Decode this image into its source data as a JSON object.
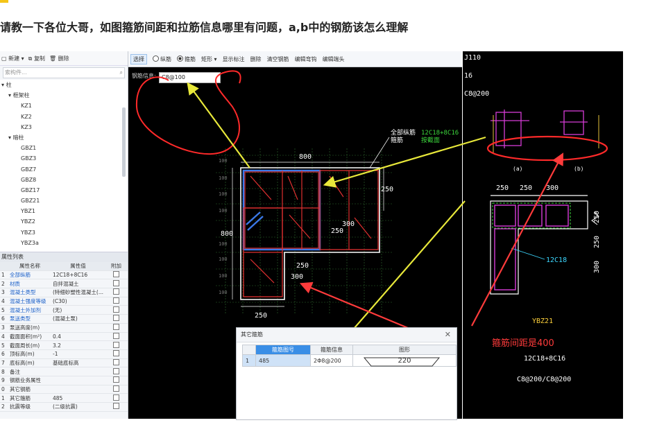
{
  "question": "请教一下各位大哥，如图箍筋间距和拉筋信息哪里有问题，a,b中的钢筋该怎么理解",
  "left_panel": {
    "toolbar": {
      "new": "新建",
      "copy": "复制",
      "delete": "删除"
    },
    "search_placeholder": "索构件...",
    "tree": [
      "柱",
      "框架柱",
      "KZ1",
      "KZ2",
      "KZ3",
      "暗柱",
      "GBZ1",
      "GBZ3",
      "GBZ7",
      "GBZ8",
      "GBZ17",
      "GBZ21",
      "YBZ1",
      "YBZ2",
      "YBZ3",
      "YBZ3a"
    ],
    "props_title": "属性列表",
    "props_header": {
      "name": "属性名称",
      "value": "属性值",
      "extra": "附加"
    },
    "props": [
      {
        "n": "1",
        "name": "全部纵筋",
        "value": "12C18+8C16"
      },
      {
        "n": "2",
        "name": "材质",
        "value": "自拌混凝土"
      },
      {
        "n": "3",
        "name": "混凝土类型",
        "value": "(特细砂塑性混凝土(..."
      },
      {
        "n": "4",
        "name": "混凝土强度等级",
        "value": "(C30)"
      },
      {
        "n": "5",
        "name": "混凝土外加剂",
        "value": "(无)"
      },
      {
        "n": "6",
        "name": "泵送类型",
        "value": "(混凝土泵)"
      },
      {
        "n": "3",
        "name": "泵送高度(m)",
        "value": ""
      },
      {
        "n": "4",
        "name": "截面面积(m²)",
        "value": "0.4"
      },
      {
        "n": "5",
        "name": "截面周长(m)",
        "value": "3.2"
      },
      {
        "n": "6",
        "name": "顶标高(m)",
        "value": "-1"
      },
      {
        "n": "7",
        "name": "底标高(m)",
        "value": "基础底标高"
      },
      {
        "n": "8",
        "name": "备注",
        "value": ""
      },
      {
        "n": "9",
        "name": "钢筋业务属性",
        "value": ""
      },
      {
        "n": "0",
        "name": "其它钢筋",
        "value": ""
      },
      {
        "n": "1",
        "name": "其它箍筋",
        "value": "485"
      },
      {
        "n": "2",
        "name": "抗震等级",
        "value": "(二级抗震)"
      }
    ]
  },
  "cad_toolbar": {
    "select": "选择",
    "longitudinal": "纵筋",
    "stirrup": "箍筋",
    "rect": "矩形",
    "show_label": "显示标注",
    "delete": "删除",
    "clear": "清空钢筋",
    "edit_hook": "编辑弯钩",
    "edit_end": "编辑端头"
  },
  "rebar_info_label": "钢筋信息",
  "rebar_info_value": "C8@100",
  "drawing": {
    "dim_800_top": "800",
    "dim_800_left": "800",
    "dim_250_right": "250",
    "dim_300": "300",
    "dim_250_mid": "250",
    "dim_250_l": "250",
    "dim_300_b": "300",
    "dim_250_bottom": "250",
    "grid_100": "100",
    "all_long_label": "全部纵筋",
    "stirrup_label": "箍筋",
    "long_value": "12C18+8C16",
    "section_label": "按截面"
  },
  "right_drawing": {
    "t1": "J110",
    "t2": "16",
    "t3": "C8@200",
    "a": "(a)",
    "b": "(b)",
    "d1": "250",
    "d2": "250",
    "d3": "300",
    "d4": "250",
    "d5": "250",
    "d6": "300",
    "bar": "12C18",
    "name": "YBZ21",
    "long": "12C18+8C16",
    "stir": "C8@200/C8@200"
  },
  "dialog": {
    "title": "其它箍筋",
    "headers": {
      "no": "箍筋图号",
      "info": "箍筋信息",
      "shape": "图形"
    },
    "row": {
      "idx": "1",
      "no": "485",
      "info": "2Φ8@200",
      "shape_val": "220"
    }
  },
  "annotation": "箍筋间距是400",
  "colors": {
    "accent": "#3a8ee6",
    "annotation": "#ff3b3b",
    "arrow_yellow": "#e8e83a"
  }
}
